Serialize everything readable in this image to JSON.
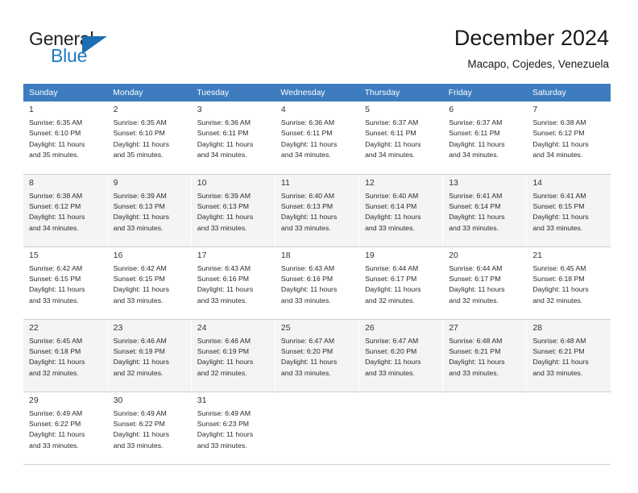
{
  "brand": {
    "name_part1": "General",
    "name_part2": "Blue",
    "accent_color": "#1e7ac0",
    "flag_icon": "triangle-flag-icon"
  },
  "header": {
    "title": "December 2024",
    "subtitle": "Macapo, Cojedes, Venezuela"
  },
  "theme": {
    "header_row_bg": "#3c7cbf",
    "header_row_text": "#ffffff",
    "alt_row_bg": "#f4f4f4",
    "grid_line": "#cfcfcf"
  },
  "weekdays": [
    "Sunday",
    "Monday",
    "Tuesday",
    "Wednesday",
    "Thursday",
    "Friday",
    "Saturday"
  ],
  "labels": {
    "sunrise_prefix": "Sunrise:",
    "sunset_prefix": "Sunset:",
    "daylight_prefix": "Daylight:"
  },
  "weeks": [
    {
      "shaded": false,
      "days": [
        {
          "num": "1",
          "l1": "Sunrise: 6:35 AM",
          "l2": "Sunset: 6:10 PM",
          "l3": "Daylight: 11 hours",
          "l4": "and 35 minutes."
        },
        {
          "num": "2",
          "l1": "Sunrise: 6:35 AM",
          "l2": "Sunset: 6:10 PM",
          "l3": "Daylight: 11 hours",
          "l4": "and 35 minutes."
        },
        {
          "num": "3",
          "l1": "Sunrise: 6:36 AM",
          "l2": "Sunset: 6:11 PM",
          "l3": "Daylight: 11 hours",
          "l4": "and 34 minutes."
        },
        {
          "num": "4",
          "l1": "Sunrise: 6:36 AM",
          "l2": "Sunset: 6:11 PM",
          "l3": "Daylight: 11 hours",
          "l4": "and 34 minutes."
        },
        {
          "num": "5",
          "l1": "Sunrise: 6:37 AM",
          "l2": "Sunset: 6:11 PM",
          "l3": "Daylight: 11 hours",
          "l4": "and 34 minutes."
        },
        {
          "num": "6",
          "l1": "Sunrise: 6:37 AM",
          "l2": "Sunset: 6:11 PM",
          "l3": "Daylight: 11 hours",
          "l4": "and 34 minutes."
        },
        {
          "num": "7",
          "l1": "Sunrise: 6:38 AM",
          "l2": "Sunset: 6:12 PM",
          "l3": "Daylight: 11 hours",
          "l4": "and 34 minutes."
        }
      ]
    },
    {
      "shaded": true,
      "days": [
        {
          "num": "8",
          "l1": "Sunrise: 6:38 AM",
          "l2": "Sunset: 6:12 PM",
          "l3": "Daylight: 11 hours",
          "l4": "and 34 minutes."
        },
        {
          "num": "9",
          "l1": "Sunrise: 6:39 AM",
          "l2": "Sunset: 6:13 PM",
          "l3": "Daylight: 11 hours",
          "l4": "and 33 minutes."
        },
        {
          "num": "10",
          "l1": "Sunrise: 6:39 AM",
          "l2": "Sunset: 6:13 PM",
          "l3": "Daylight: 11 hours",
          "l4": "and 33 minutes."
        },
        {
          "num": "11",
          "l1": "Sunrise: 6:40 AM",
          "l2": "Sunset: 6:13 PM",
          "l3": "Daylight: 11 hours",
          "l4": "and 33 minutes."
        },
        {
          "num": "12",
          "l1": "Sunrise: 6:40 AM",
          "l2": "Sunset: 6:14 PM",
          "l3": "Daylight: 11 hours",
          "l4": "and 33 minutes."
        },
        {
          "num": "13",
          "l1": "Sunrise: 6:41 AM",
          "l2": "Sunset: 6:14 PM",
          "l3": "Daylight: 11 hours",
          "l4": "and 33 minutes."
        },
        {
          "num": "14",
          "l1": "Sunrise: 6:41 AM",
          "l2": "Sunset: 6:15 PM",
          "l3": "Daylight: 11 hours",
          "l4": "and 33 minutes."
        }
      ]
    },
    {
      "shaded": false,
      "days": [
        {
          "num": "15",
          "l1": "Sunrise: 6:42 AM",
          "l2": "Sunset: 6:15 PM",
          "l3": "Daylight: 11 hours",
          "l4": "and 33 minutes."
        },
        {
          "num": "16",
          "l1": "Sunrise: 6:42 AM",
          "l2": "Sunset: 6:15 PM",
          "l3": "Daylight: 11 hours",
          "l4": "and 33 minutes."
        },
        {
          "num": "17",
          "l1": "Sunrise: 6:43 AM",
          "l2": "Sunset: 6:16 PM",
          "l3": "Daylight: 11 hours",
          "l4": "and 33 minutes."
        },
        {
          "num": "18",
          "l1": "Sunrise: 6:43 AM",
          "l2": "Sunset: 6:16 PM",
          "l3": "Daylight: 11 hours",
          "l4": "and 33 minutes."
        },
        {
          "num": "19",
          "l1": "Sunrise: 6:44 AM",
          "l2": "Sunset: 6:17 PM",
          "l3": "Daylight: 11 hours",
          "l4": "and 32 minutes."
        },
        {
          "num": "20",
          "l1": "Sunrise: 6:44 AM",
          "l2": "Sunset: 6:17 PM",
          "l3": "Daylight: 11 hours",
          "l4": "and 32 minutes."
        },
        {
          "num": "21",
          "l1": "Sunrise: 6:45 AM",
          "l2": "Sunset: 6:18 PM",
          "l3": "Daylight: 11 hours",
          "l4": "and 32 minutes."
        }
      ]
    },
    {
      "shaded": true,
      "days": [
        {
          "num": "22",
          "l1": "Sunrise: 6:45 AM",
          "l2": "Sunset: 6:18 PM",
          "l3": "Daylight: 11 hours",
          "l4": "and 32 minutes."
        },
        {
          "num": "23",
          "l1": "Sunrise: 6:46 AM",
          "l2": "Sunset: 6:19 PM",
          "l3": "Daylight: 11 hours",
          "l4": "and 32 minutes."
        },
        {
          "num": "24",
          "l1": "Sunrise: 6:46 AM",
          "l2": "Sunset: 6:19 PM",
          "l3": "Daylight: 11 hours",
          "l4": "and 32 minutes."
        },
        {
          "num": "25",
          "l1": "Sunrise: 6:47 AM",
          "l2": "Sunset: 6:20 PM",
          "l3": "Daylight: 11 hours",
          "l4": "and 33 minutes."
        },
        {
          "num": "26",
          "l1": "Sunrise: 6:47 AM",
          "l2": "Sunset: 6:20 PM",
          "l3": "Daylight: 11 hours",
          "l4": "and 33 minutes."
        },
        {
          "num": "27",
          "l1": "Sunrise: 6:48 AM",
          "l2": "Sunset: 6:21 PM",
          "l3": "Daylight: 11 hours",
          "l4": "and 33 minutes."
        },
        {
          "num": "28",
          "l1": "Sunrise: 6:48 AM",
          "l2": "Sunset: 6:21 PM",
          "l3": "Daylight: 11 hours",
          "l4": "and 33 minutes."
        }
      ]
    },
    {
      "shaded": false,
      "days": [
        {
          "num": "29",
          "l1": "Sunrise: 6:49 AM",
          "l2": "Sunset: 6:22 PM",
          "l3": "Daylight: 11 hours",
          "l4": "and 33 minutes."
        },
        {
          "num": "30",
          "l1": "Sunrise: 6:49 AM",
          "l2": "Sunset: 6:22 PM",
          "l3": "Daylight: 11 hours",
          "l4": "and 33 minutes."
        },
        {
          "num": "31",
          "l1": "Sunrise: 6:49 AM",
          "l2": "Sunset: 6:23 PM",
          "l3": "Daylight: 11 hours",
          "l4": "and 33 minutes."
        },
        null,
        null,
        null,
        null
      ]
    }
  ]
}
